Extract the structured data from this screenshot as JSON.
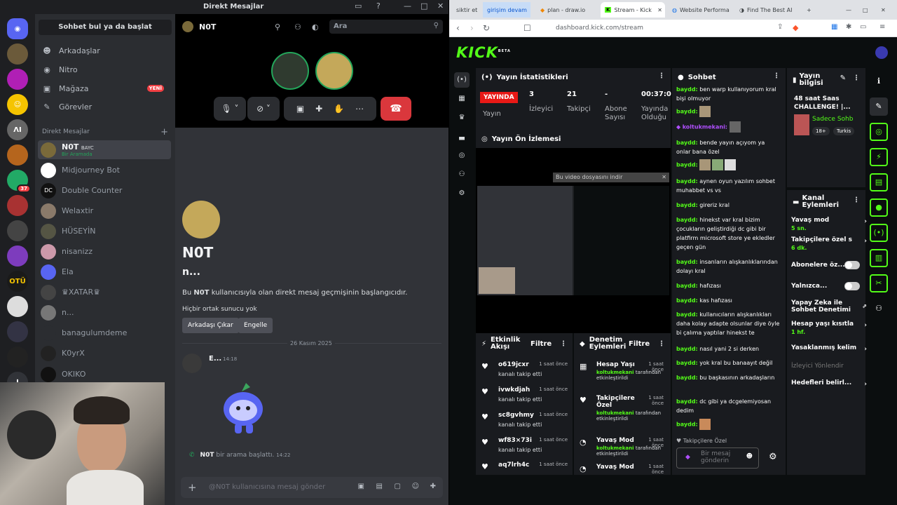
{
  "discord": {
    "window_title": "Direkt Mesajlar",
    "find_button": "Sohbet bul ya da başlat",
    "nav": [
      {
        "label": "Arkadaşlar",
        "icon": "friends-icon"
      },
      {
        "label": "Nitro",
        "icon": "nitro-icon"
      },
      {
        "label": "Mağaza",
        "icon": "shop-icon",
        "badge": "YENİ"
      },
      {
        "label": "Görevler",
        "icon": "quests-icon"
      }
    ],
    "dm_header": "Direkt Mesajlar",
    "dms": [
      {
        "name": "N0T",
        "tag": "BAYC",
        "sub": "Bir Aramada",
        "selected": true
      },
      {
        "name": "Midjourney Bot"
      },
      {
        "name": "Double Counter"
      },
      {
        "name": "Welaxtir"
      },
      {
        "name": "HÜSEYİN"
      },
      {
        "name": "nisanizz"
      },
      {
        "name": "Ela"
      },
      {
        "name": "♛XATAR♛"
      },
      {
        "name": "n..."
      },
      {
        "name": "banagulumdeme"
      },
      {
        "name": "K0yrX"
      },
      {
        "name": "OKIKO"
      }
    ],
    "guild_badge": "37",
    "guild_letters": [
      "OTÜ",
      "ΛI"
    ],
    "channel": {
      "name": "N0T",
      "search_placeholder": "Ara",
      "profile_name": "N0T",
      "profile_user": "n...",
      "desc_pre": "Bu ",
      "desc_name": "N0T",
      "desc_post": " kullanıcısıyla olan direkt mesaj geçmişinin başlangıcıdır.",
      "no_common": "Hiçbir ortak sunucu yok",
      "btn_remove": "Arkadaşı Çıkar",
      "btn_block": "Engelle",
      "date": "26 Kasım 2025",
      "msg_author": "E...",
      "msg_time": "14:18",
      "call_author": "N0T",
      "call_text": "bir arama başlattı.",
      "call_time": "14:22",
      "input_placeholder": "@N0T kullanıcısına mesaj gönder"
    }
  },
  "browser": {
    "tabs": [
      {
        "label": "siktir et"
      },
      {
        "label": "girişim devam"
      },
      {
        "label": "plan - draw.io"
      },
      {
        "label": "Stream - Kick",
        "active": true
      },
      {
        "label": "Website Performa"
      },
      {
        "label": "Find The Best AI"
      }
    ],
    "url": "dashboard.kick.com/stream"
  },
  "kick": {
    "logo": "KICK",
    "logo_sup": "BETA",
    "stats": {
      "title": "Yayın İstatistikleri",
      "live": "YAYINDA",
      "live_label": "Yayın",
      "viewers": "3",
      "viewers_label": "İzleyici",
      "followers": "21",
      "followers_label": "Takipçi",
      "subs": "-",
      "subs_label": "Abone Sayısı",
      "uptime": "00:37:0",
      "uptime_label": "Yayında Olduğu"
    },
    "preview": {
      "title": "Yayın Ön İzlemesi",
      "download": "Bu video dosyasını indir"
    },
    "activity": {
      "title": "Etkinlik Akışı",
      "filter": "Filtre",
      "items": [
        {
          "name": "o619jcxr",
          "ago": "1 saat önce",
          "desc": "kanalı takip etti"
        },
        {
          "name": "ivwkdjah",
          "ago": "1 saat önce",
          "desc": "kanalı takip etti"
        },
        {
          "name": "sc8gvhmy",
          "ago": "1 saat önce",
          "desc": "kanalı takip etti"
        },
        {
          "name": "wf83×73i",
          "ago": "1 saat önce",
          "desc": "kanalı takip etti"
        },
        {
          "name": "aq7lrh4c",
          "ago": "1 saat önce",
          "desc": ""
        }
      ]
    },
    "modlog": {
      "title": "Denetim Eylemleri",
      "filter": "Filtre",
      "items": [
        {
          "name": "Hesap Yaşı",
          "ago": "1 saat önce",
          "by": "koltukmekani",
          "desc": "tarafından etkinleştirildi"
        },
        {
          "name": "Takipçilere Özel",
          "ago": "1 saat önce",
          "by": "koltukmekani",
          "desc": "tarafından etkinleştirildi"
        },
        {
          "name": "Yavaş Mod",
          "ago": "1 saat önce",
          "by": "koltukmekani",
          "desc": "tarafından etkinleştirildi"
        },
        {
          "name": "Yavaş Mod",
          "ago": "1 saat önce",
          "by": "",
          "desc": ""
        }
      ]
    },
    "chat": {
      "title": "Sohbet",
      "messages": [
        {
          "user": "baydd:",
          "text": "ben warp kullanıyorum kral bişi olmuyor"
        },
        {
          "user": "baydd:",
          "text": ""
        },
        {
          "user": "koltukmekani:",
          "text": ""
        },
        {
          "user": "baydd:",
          "text": "bende yayın açıyom ya onlar bana özel"
        },
        {
          "user": "baydd:",
          "text": ""
        },
        {
          "user": "baydd:",
          "text": "aynen oyun yazılım sohbet muhabbet vs vs"
        },
        {
          "user": "baydd:",
          "text": "gireriz kral"
        },
        {
          "user": "baydd:",
          "text": "hinekst var kral bizim çocukların geliştirdiği dc gibi bir platfirm microsoft store ye ekledler geçen gün"
        },
        {
          "user": "baydd:",
          "text": "insanların alışkanlıklarından dolayı kral"
        },
        {
          "user": "baydd:",
          "text": "hafızası"
        },
        {
          "user": "baydd:",
          "text": "kas hafızası"
        },
        {
          "user": "baydd:",
          "text": "kullanıcıların alışkanlıkları daha kolay adapte olsunlar diye öyle bi çalıma yaptılar hinekst te"
        },
        {
          "user": "baydd:",
          "text": "nasıl yani 2 si derken"
        },
        {
          "user": "baydd:",
          "text": "yok kral bu banaayıt değil"
        },
        {
          "user": "baydd:",
          "text": "bu başkasının arkadaşların"
        },
        {
          "user": "baydd:",
          "text": "dc gibi ya dcgelemiyosan dedim"
        },
        {
          "user": "baydd:",
          "text": ""
        }
      ],
      "mode": "Takipçilere Özel",
      "input_placeholder": "Bir mesaj gönderin"
    },
    "info": {
      "title": "Yayın bilgisi",
      "stream_title": "48 saat Saas CHALLENGE! |...",
      "category": "Sadece Sohb",
      "tags": [
        "18+",
        "Turkis"
      ]
    },
    "actions": {
      "title": "Kanal Eylemleri",
      "items": [
        {
          "label": "Yavaş mod",
          "sub": "5 sn.",
          "type": "arrow"
        },
        {
          "label": "Takipçilere özel s",
          "sub": "6 dk.",
          "type": "arrow"
        },
        {
          "label": "Abonelere öz...",
          "sub": "",
          "type": "toggle"
        },
        {
          "label": "Yalnızca...",
          "sub": "",
          "type": "toggle"
        },
        {
          "label": "Yapay Zeka ile Sohbet Denetimi",
          "sub": "",
          "type": "link"
        },
        {
          "label": "Hesap yaşı kısıtla",
          "sub": "1 hf.",
          "type": "arrow"
        },
        {
          "label": "Yasaklanmış kelim",
          "sub": "",
          "type": "arrow"
        },
        {
          "label": "İzleyici Yönlendir",
          "sub": "",
          "type": "disabled"
        },
        {
          "label": "Hedefleri belirl...",
          "sub": "",
          "type": "arrow"
        }
      ]
    }
  }
}
